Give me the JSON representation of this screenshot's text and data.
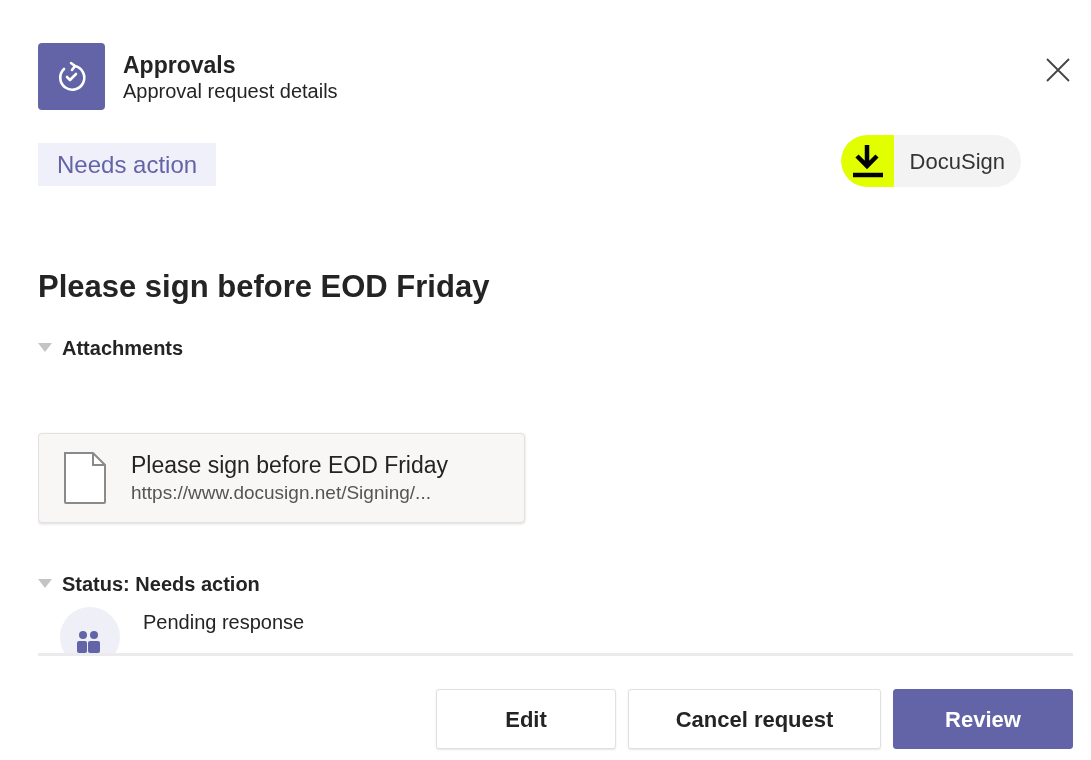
{
  "header": {
    "app_name": "Approvals",
    "subtitle": "Approval request details"
  },
  "status_badge": "Needs action",
  "provider": {
    "name": "DocuSign"
  },
  "title": "Please sign before EOD Friday",
  "sections": [
    {
      "kind": "attachments",
      "label": "Attachments",
      "expanded": true,
      "attachments": [
        {
          "name": "Please sign before EOD Friday",
          "url": "https://www.docusign.net/Signing/..."
        }
      ]
    },
    {
      "kind": "status",
      "label": "Status: Needs action",
      "expanded": true,
      "responses": [
        {
          "label": "Pending response"
        }
      ]
    }
  ],
  "buttons": [
    {
      "label": "Edit",
      "primary": false
    },
    {
      "label": "Cancel request",
      "primary": false
    },
    {
      "label": "Review",
      "primary": true
    }
  ]
}
